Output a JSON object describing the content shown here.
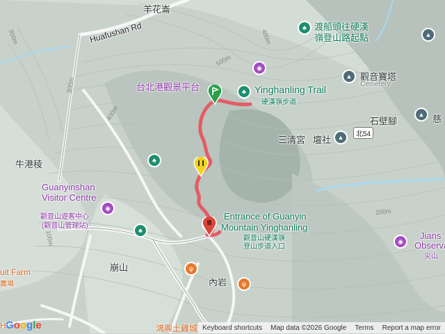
{
  "labels": {
    "yanghuaqi": "羊花崙",
    "huafushan_rd": "Huafushan Rd",
    "ferry_trail_line1": "渡船頭往硬漢",
    "ferry_trail_line2": "嶺登山路起點",
    "guanyin_pagoda": "觀音寶塔",
    "cemetery": "Cemetery",
    "taipei_port_deck": "台北港觀景平台",
    "yinghanling_trail_en": "Yinghanling Trail",
    "yinghanling_trail_zh": "硬漢嶺步道",
    "shibijiao": "石壁腳",
    "ci": "慈",
    "sanqinggong": "三清宮",
    "tanshe": "壇社",
    "bei54": "北54",
    "niugangling": "牛港稜",
    "visitor_centre_en_1": "Guanyinshan",
    "visitor_centre_en_2": "Visitor Centre",
    "visitor_centre_zh_1": "觀音山遊客中心",
    "visitor_centre_zh_2": "(觀音山管理站)",
    "entrance_en_1": "Entrance of Guanyin",
    "entrance_en_2": "Mountain Yinghanling",
    "entrance_zh_1": "觀音山硬漢嶺",
    "entrance_zh_2": "登山步道入口",
    "jians_1": "Jians",
    "jians_2": "Observa",
    "jians_3": "尖山",
    "bengshan": "崩山",
    "neiyan": "內岩",
    "fruit_farm_1": "uit Farm",
    "fruit_farm_2": "農場",
    "chicken": "鴻興土雞城",
    "contour_500": "500m",
    "contour_400a": "400m",
    "contour_400b": "400m",
    "contour_300a": "300m",
    "contour_300b": "300m",
    "contour_200": "200m",
    "contour_100": "100m"
  },
  "icons": {
    "park": "tree-icon",
    "attraction": "camera-icon",
    "temple": "temple-icon",
    "restaurant": "fork-knife-icon",
    "start": "flag-icon",
    "end": "map-pin-icon",
    "waypoint": "pause-icon"
  },
  "colors": {
    "route": "#e45b66",
    "park_green": "#1e8f6e",
    "attraction_purple": "#a44bc0",
    "food_orange": "#e7792b",
    "start_green": "#2aa04a",
    "waypoint_yellow": "#f3d31c",
    "end_red": "#d9453a"
  },
  "attribution": {
    "shortcuts": "Keyboard shortcuts",
    "map_data": "Map data ©2026 Google",
    "terms": "Terms",
    "report": "Report a map error"
  },
  "google_logo": "Google",
  "edge_text": "H"
}
